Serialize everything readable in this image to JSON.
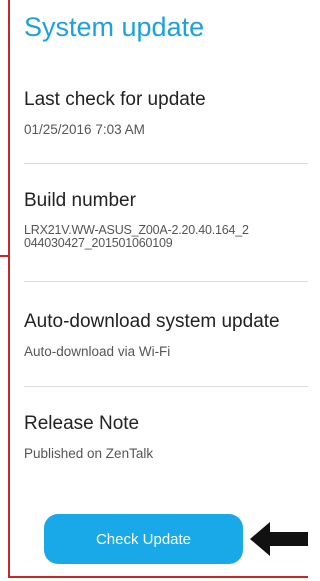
{
  "page": {
    "title": "System update",
    "accent_color": "#1ba1e2",
    "highlight_color": "#c62828"
  },
  "settings": {
    "last_check": {
      "label": "Last check for update",
      "summary": "01/25/2016 7:03 AM"
    },
    "build_number": {
      "label": "Build number",
      "line1": "LRX21V.WW-ASUS_Z00A-2.20.40.164_2",
      "line2": "044030427_201501060109"
    },
    "auto_download": {
      "label": "Auto-download system update",
      "summary": "Auto-download via Wi-Fi"
    },
    "release_note": {
      "label": "Release Note",
      "summary": "Published on ZenTalk"
    }
  },
  "actions": {
    "check_update_label": "Check Update"
  },
  "annotation": {
    "icon": "left-arrow-icon"
  }
}
